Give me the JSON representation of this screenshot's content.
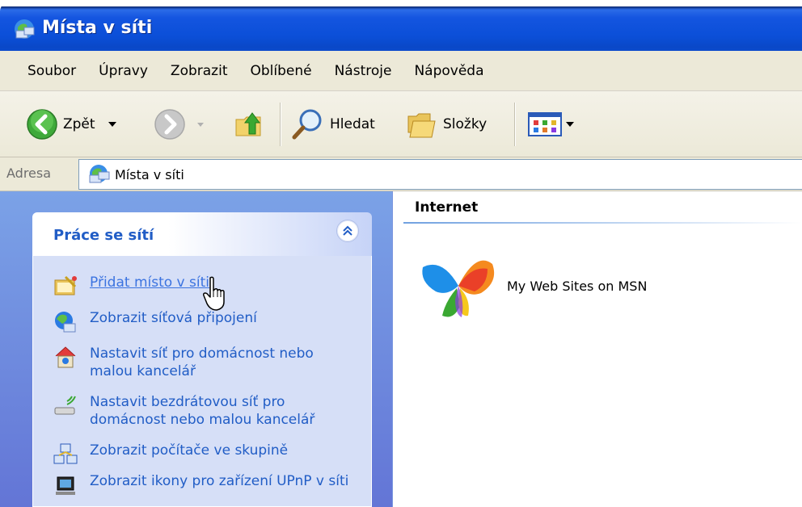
{
  "window": {
    "title": "Místa v síti",
    "icon": "network-places-icon"
  },
  "menu": {
    "items": [
      "Soubor",
      "Úpravy",
      "Zobrazit",
      "Oblíbené",
      "Nástroje",
      "Nápověda"
    ]
  },
  "toolbar": {
    "back_label": "Zpět",
    "search_label": "Hledat",
    "folders_label": "Složky"
  },
  "address": {
    "label": "Adresa",
    "value": "Místa v síti"
  },
  "taskpane": {
    "group_title": "Práce se sítí",
    "tasks": [
      {
        "label": "Přidat místo v síti",
        "icon": "add-network-place-icon"
      },
      {
        "label": "Zobrazit síťová připojení",
        "icon": "network-connections-icon"
      },
      {
        "label": "Nastavit síť pro domácnost nebo malou kancelář",
        "icon": "home-network-icon"
      },
      {
        "label": "Nastavit bezdrátovou síť pro domácnost nebo malou kancelář",
        "icon": "wireless-network-icon"
      },
      {
        "label": "Zobrazit počítače ve skupině",
        "icon": "workgroup-computers-icon"
      },
      {
        "label": "Zobrazit ikony pro zařízení UPnP v síti",
        "icon": "upnp-device-icon"
      }
    ]
  },
  "content": {
    "section_title": "Internet",
    "items": [
      {
        "label": "My Web Sites on MSN",
        "icon": "msn-butterfly-icon"
      }
    ]
  },
  "colors": {
    "titlebar": "#0b4fd8",
    "taskpane_bg": "#7ba2e7",
    "task_link": "#215dc6",
    "menubar_bg": "#ece9d8"
  }
}
